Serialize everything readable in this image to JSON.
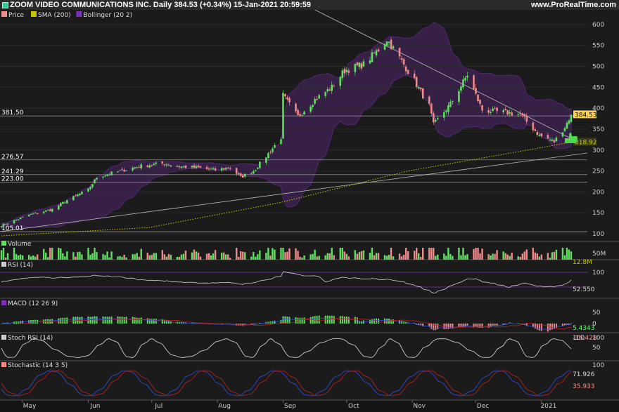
{
  "header": {
    "title": "ZOOM VIDEO COMMUNICATIONS INC. Daily 384.53 (+0.34%) 15-Jan-2021 20:59:59",
    "site": "www.ProRealTime.com"
  },
  "colors": {
    "up": "#5fe05f",
    "down": "#f08a8a",
    "bollinger": "#7e2fb8",
    "sma": "#c8c800",
    "background": "#141414",
    "grid": "#2a2a2a"
  },
  "chart_data": {
    "type": "candlestick",
    "date_range": [
      "2020-04-21",
      "2021-01-15"
    ],
    "x_tick_labels": [
      "May",
      "Jun",
      "Jul",
      "Aug",
      "Sep",
      "Oct",
      "Nov",
      "Dec",
      "2021"
    ],
    "price_panel": {
      "legend": [
        "Price",
        "SMA (200)",
        "Bollinger (20 2)"
      ],
      "ylim": [
        85,
        625
      ],
      "y_ticks": [
        100,
        150,
        200,
        250,
        300,
        350,
        400,
        450,
        500,
        550,
        600
      ],
      "horizontal_levels": [
        105.01,
        223.0,
        241.29,
        276.57,
        381.5
      ],
      "right_labels": [
        {
          "text": "384.53",
          "value": 384.53,
          "color": "#ffd24d"
        },
        {
          "text": "318.92",
          "value": 318.92,
          "color": "#c8c800"
        }
      ],
      "close_anchors": [
        {
          "date": "2020-04-21",
          "close": 120
        },
        {
          "date": "2020-05-04",
          "close": 145
        },
        {
          "date": "2020-05-15",
          "close": 158
        },
        {
          "date": "2020-05-22",
          "close": 180
        },
        {
          "date": "2020-06-01",
          "close": 205
        },
        {
          "date": "2020-06-05",
          "close": 235
        },
        {
          "date": "2020-06-12",
          "close": 245
        },
        {
          "date": "2020-06-26",
          "close": 262
        },
        {
          "date": "2020-07-06",
          "close": 268
        },
        {
          "date": "2020-07-15",
          "close": 260
        },
        {
          "date": "2020-07-22",
          "close": 258
        },
        {
          "date": "2020-07-31",
          "close": 252
        },
        {
          "date": "2020-08-07",
          "close": 258
        },
        {
          "date": "2020-08-12",
          "close": 235
        },
        {
          "date": "2020-08-18",
          "close": 250
        },
        {
          "date": "2020-08-24",
          "close": 285
        },
        {
          "date": "2020-08-31",
          "close": 330
        },
        {
          "date": "2020-09-01",
          "close": 430
        },
        {
          "date": "2020-09-08",
          "close": 380
        },
        {
          "date": "2020-09-16",
          "close": 420
        },
        {
          "date": "2020-09-24",
          "close": 450
        },
        {
          "date": "2020-09-30",
          "close": 490
        },
        {
          "date": "2020-10-09",
          "close": 505
        },
        {
          "date": "2020-10-16",
          "close": 540
        },
        {
          "date": "2020-10-20",
          "close": 565
        },
        {
          "date": "2020-10-26",
          "close": 520
        },
        {
          "date": "2020-11-02",
          "close": 465
        },
        {
          "date": "2020-11-09",
          "close": 405
        },
        {
          "date": "2020-11-11",
          "close": 360
        },
        {
          "date": "2020-11-19",
          "close": 410
        },
        {
          "date": "2020-11-27",
          "close": 480
        },
        {
          "date": "2020-12-04",
          "close": 395
        },
        {
          "date": "2020-12-14",
          "close": 390
        },
        {
          "date": "2020-12-22",
          "close": 385
        },
        {
          "date": "2020-12-31",
          "close": 335
        },
        {
          "date": "2021-01-07",
          "close": 320
        },
        {
          "date": "2021-01-12",
          "close": 355
        },
        {
          "date": "2021-01-15",
          "close": 384.53
        }
      ],
      "sma_anchors": [
        {
          "date": "2020-04-21",
          "close": 95
        },
        {
          "date": "2020-06-30",
          "close": 115
        },
        {
          "date": "2020-08-31",
          "close": 175
        },
        {
          "date": "2020-10-30",
          "close": 250
        },
        {
          "date": "2020-12-31",
          "close": 305
        },
        {
          "date": "2021-01-15",
          "close": 318.92
        }
      ]
    },
    "volume_panel": {
      "label": "Volume",
      "axis_ticks": [
        "50M"
      ],
      "last_label": "12.8M"
    },
    "rsi_panel": {
      "label": "RSI (14)",
      "axis_ticks": [
        "100"
      ],
      "last_label": "52.550"
    },
    "macd_panel": {
      "label": "MACD (12 26 9)",
      "axis_ticks": [
        "50",
        "0"
      ],
      "last_labels": [
        "5.4343",
        "-16.428"
      ]
    },
    "stoch_rsi_panel": {
      "label": "Stoch RSI (14)",
      "axis_ticks": [
        "100",
        "50"
      ],
      "last_label": "100"
    },
    "stochastic_panel": {
      "label": "Stochastic (14 3 5)",
      "axis_ticks": [
        "100"
      ],
      "last_labels": [
        "71.926",
        "35.933"
      ]
    }
  }
}
